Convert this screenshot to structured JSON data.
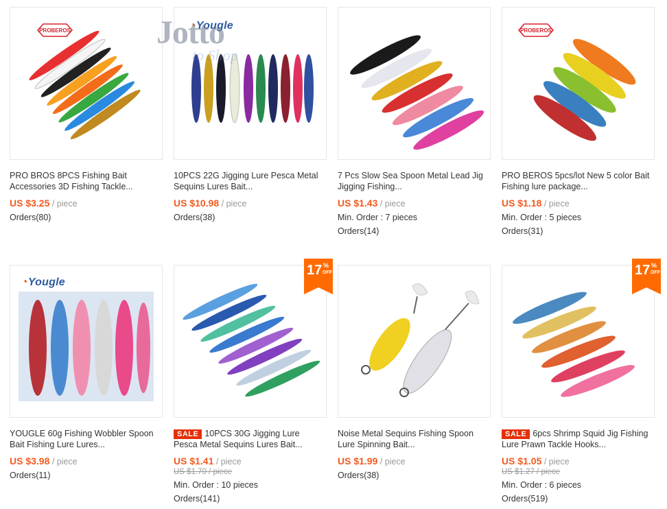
{
  "watermark": {
    "main": "Jotto",
    "sub": "to Shop"
  },
  "colors": {
    "price": "#f25a1f",
    "sale": "#e62e04",
    "discount": "#ff6b00"
  },
  "products": [
    {
      "brand": "PROBEROS",
      "title": "PRO BROS 8PCS Fishing Bait Accessories 3D Fishing Tackle...",
      "price": "US $3.25",
      "unit": "/ piece",
      "orders": "Orders(80)"
    },
    {
      "brand": "Yougle",
      "title": "10PCS 22G Jigging Lure Pesca Metal Sequins Lures Bait...",
      "price": "US $10.98",
      "unit": "/ piece",
      "orders": "Orders(38)"
    },
    {
      "title": "7 Pcs Slow Sea Spoon Metal Lead Jig Jigging Fishing...",
      "price": "US $1.43",
      "unit": "/ piece",
      "min_order": "Min. Order : 7 pieces",
      "orders": "Orders(14)"
    },
    {
      "brand": "PROBEROS",
      "title": "PRO BEROS 5pcs/lot New 5 color Bait Fishing lure package...",
      "price": "US $1.18",
      "unit": "/ piece",
      "min_order": "Min. Order : 5 pieces",
      "orders": "Orders(31)"
    },
    {
      "brand": "Yougle",
      "title": "YOUGLE 60g Fishing Wobbler Spoon Bait Fishing Lure Lures...",
      "price": "US $3.98",
      "unit": "/ piece",
      "orders": "Orders(11)"
    },
    {
      "sale": "SALE",
      "discount": "17",
      "discount_pct": "%",
      "discount_off": "OFF",
      "title": "10PCS 30G Jigging Lure Pesca Metal Sequins Lures Bait...",
      "price": "US $1.41",
      "unit": "/ piece",
      "old_price": "US $1.70 / piece",
      "min_order": "Min. Order : 10 pieces",
      "orders": "Orders(141)"
    },
    {
      "title": "Noise Metal Sequins Fishing Spoon Lure Spinning Bait...",
      "price": "US $1.99",
      "unit": "/ piece",
      "orders": "Orders(38)"
    },
    {
      "sale": "SALE",
      "discount": "17",
      "discount_pct": "%",
      "discount_off": "OFF",
      "title": "6pcs Shrimp Squid Jig Fishing Lure Prawn Tackle Hooks...",
      "price": "US $1.05",
      "unit": "/ piece",
      "old_price": "US $1.27 / piece",
      "min_order": "Min. Order : 6 pieces",
      "orders": "Orders(519)"
    }
  ]
}
